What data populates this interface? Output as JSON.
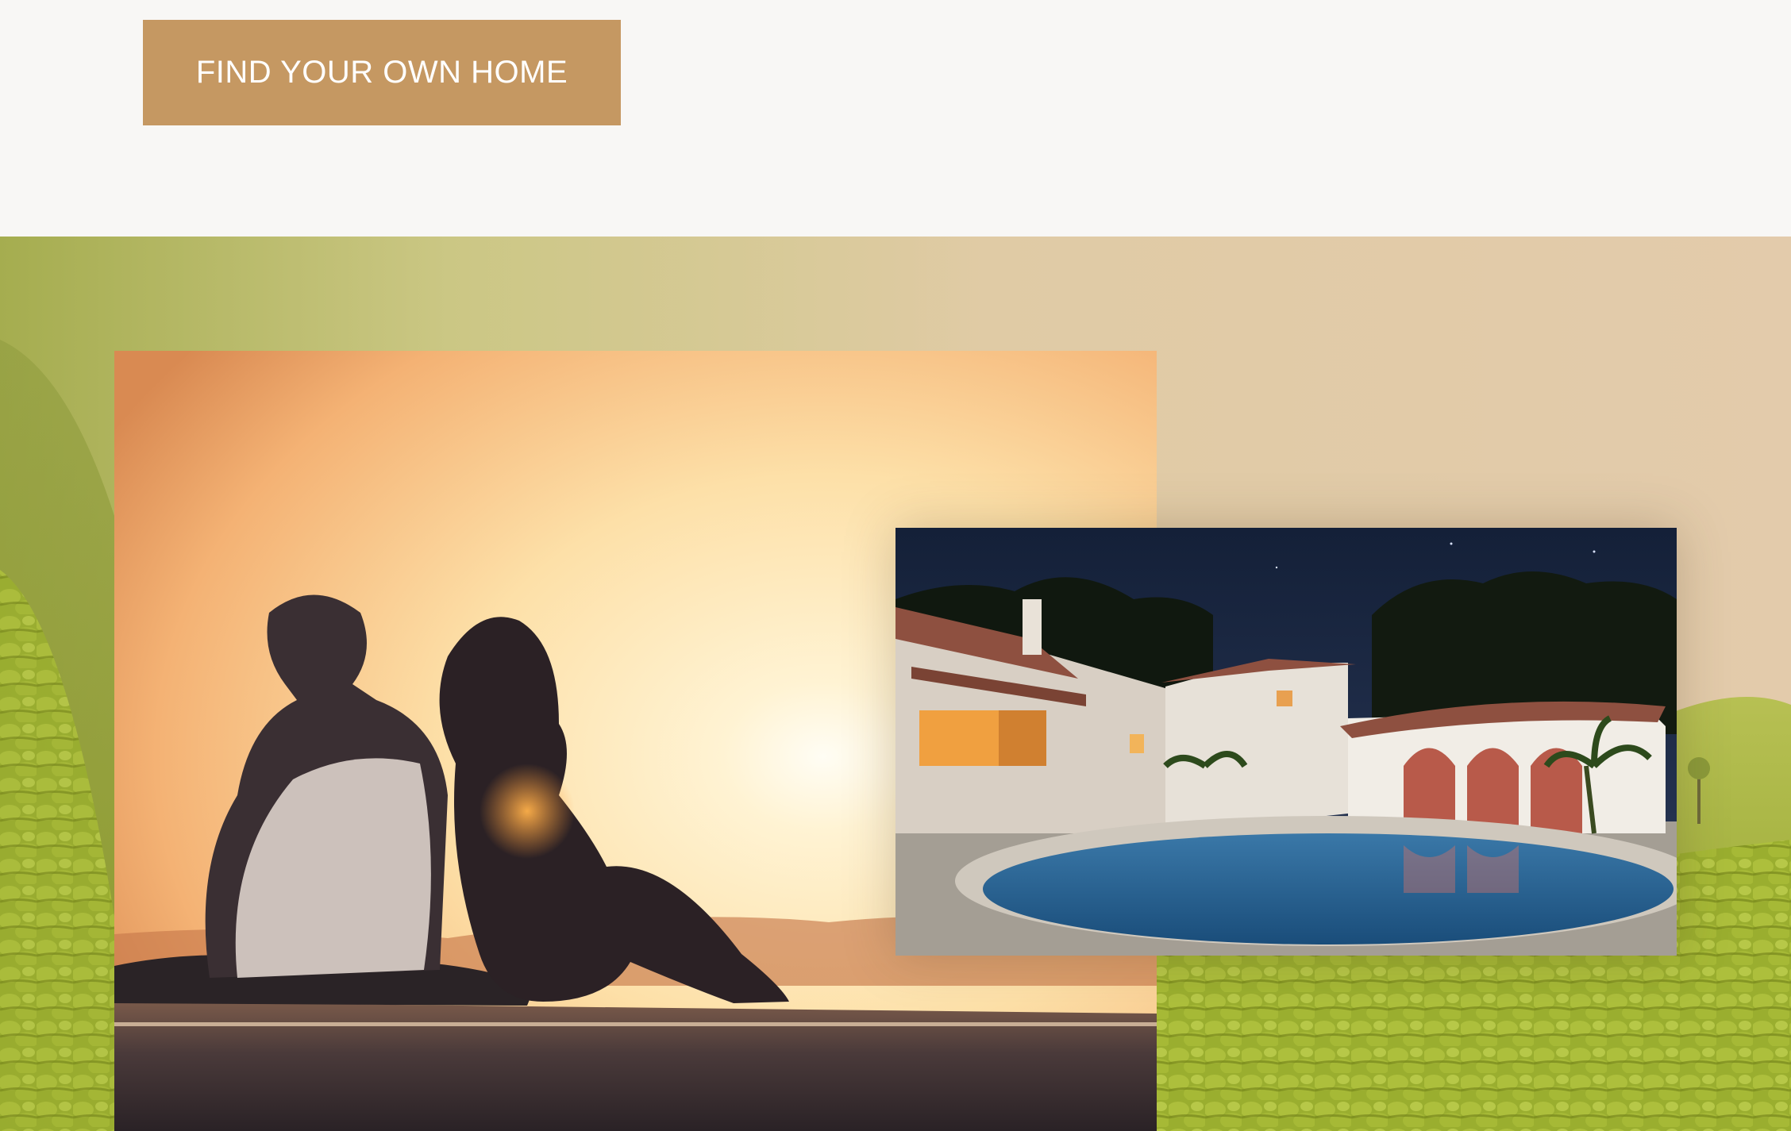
{
  "cta": {
    "label": "FIND YOUR OWN HOME"
  },
  "colors": {
    "button_bg": "#c59862",
    "button_text": "#ffffff",
    "page_bg": "#f8f7f5"
  },
  "images": {
    "background": "tea-plantation-hills-photo",
    "sunset": "couple-watching-sunset-photo",
    "villa": "villa-with-pool-at-night-photo"
  }
}
